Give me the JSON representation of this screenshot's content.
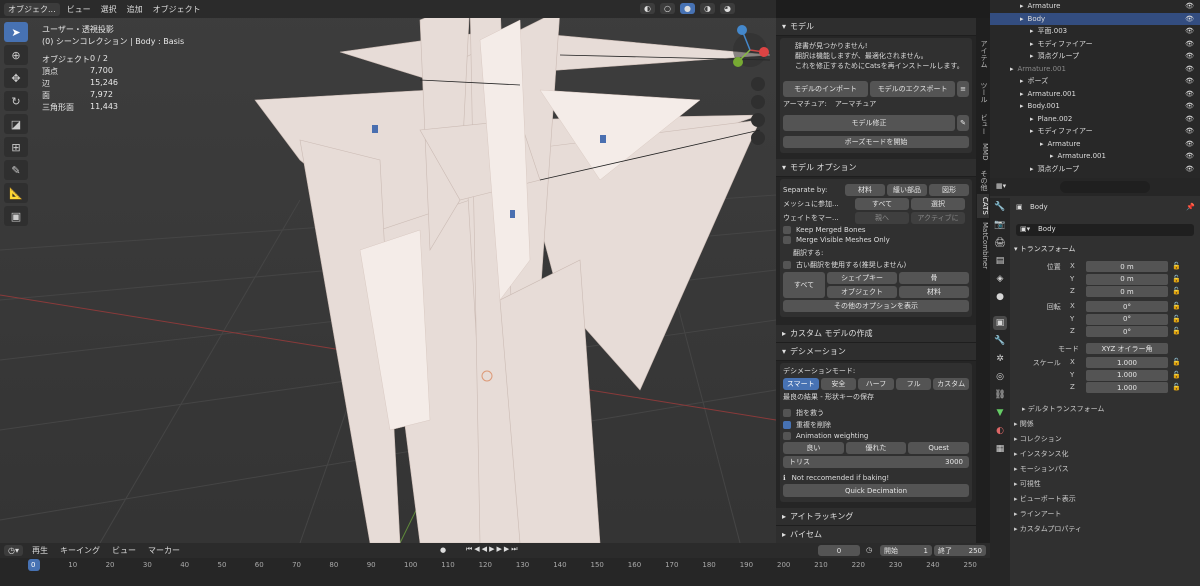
{
  "viewport": {
    "header": {
      "mode": "オブジェク...",
      "menus": [
        "ビュー",
        "選択",
        "追加",
        "オブジェクト"
      ]
    },
    "overlay": {
      "view_name": "ユーザー・透視投影",
      "collection": "(0) シーンコレクション | Body : Basis"
    },
    "stats": [
      {
        "label": "オブジェクト",
        "value": "0 / 2"
      },
      {
        "label": "頂点",
        "value": "7,700"
      },
      {
        "label": "辺",
        "value": "15,246"
      },
      {
        "label": "面",
        "value": "7,972"
      },
      {
        "label": "三角形面",
        "value": "11,443"
      }
    ]
  },
  "npanel": {
    "model_title": "モデル",
    "warning_lines": [
      "辞書が見つかりません!",
      "翻訳は機能しますが、最適化されません。",
      "これを修正するためにCatsを再インストールします。"
    ],
    "import_btn": "モデルのインポート",
    "export_btn": "モデルのエクスポート",
    "armature_label": "アーマチュア:",
    "armature_value": "アーマチュア",
    "fix_btn": "モデル修正",
    "pose_btn": "ポーズモードを開始",
    "options_title": "モデル オプション",
    "separate_by": "Separate by:",
    "sep_opts": [
      "材料",
      "緩い部品",
      "図形"
    ],
    "join_label": "メッシュに参加...",
    "join_opts": [
      "すべて",
      "選択"
    ],
    "weight_label": "ウェイトをマー...",
    "weight_opts": [
      "親へ",
      "アクティブに"
    ],
    "keep_merged": "Keep Merged Bones",
    "merge_visible": "Merge Visible Meshes Only",
    "translate_label": "翻訳する:",
    "old_translate": "古い翻訳を使用する(推奨しません)",
    "all_label": "すべて",
    "trans_opts": [
      "シェイプキー",
      "骨",
      "オブジェクト",
      "材料"
    ],
    "more_options": "その他のオプションを表示",
    "custom_title": "カスタム モデルの作成",
    "decimation_title": "デシメーション",
    "dec_mode_label": "デシメーションモード:",
    "dec_modes": [
      "スマート",
      "安全",
      "ハーフ",
      "フル",
      "カスタム"
    ],
    "dec_desc": "最良の結果 - 形状キーの保存",
    "save_fingers": "指を救う",
    "remove_doubles": "重複を削除",
    "anim_weighting": "Animation weighting",
    "quality_opts": [
      "良い",
      "優れた",
      "Quest"
    ],
    "tris_label": "トリス",
    "tris_value": "3000",
    "not_recommended": "Not reccomended if baking!",
    "quick_dec": "Quick Decimation",
    "eye_title": "アイトラッキング",
    "viseme_title": "バイセム"
  },
  "ntabs": [
    "アイテム",
    "ツール",
    "ビュー",
    "MMD",
    "その他",
    "CATS",
    "MatCombiner"
  ],
  "outliner": {
    "rows": [
      {
        "label": "Armature",
        "indent": 3,
        "dim": false,
        "selected": false
      },
      {
        "label": "Body",
        "indent": 3,
        "dim": false,
        "selected": true
      },
      {
        "label": "平面.003",
        "indent": 4,
        "dim": false,
        "selected": false
      },
      {
        "label": "モディファイアー",
        "indent": 4,
        "dim": false,
        "selected": false
      },
      {
        "label": "頂点グループ",
        "indent": 4,
        "dim": false,
        "selected": false
      },
      {
        "label": "Armature.001",
        "indent": 2,
        "dim": true,
        "selected": false
      },
      {
        "label": "ポーズ",
        "indent": 3,
        "dim": false,
        "selected": false
      },
      {
        "label": "Armature.001",
        "indent": 3,
        "dim": false,
        "selected": false
      },
      {
        "label": "Body.001",
        "indent": 3,
        "dim": false,
        "selected": false
      },
      {
        "label": "Plane.002",
        "indent": 4,
        "dim": false,
        "selected": false
      },
      {
        "label": "モディファイアー",
        "indent": 4,
        "dim": false,
        "selected": false
      },
      {
        "label": "Armature",
        "indent": 5,
        "dim": false,
        "selected": false
      },
      {
        "label": "Armature.001",
        "indent": 6,
        "dim": false,
        "selected": false
      },
      {
        "label": "頂点グループ",
        "indent": 4,
        "dim": false,
        "selected": false
      }
    ]
  },
  "properties": {
    "object_name": "Body",
    "data_name": "Body",
    "transform_title": "トランスフォーム",
    "location_label": "位置",
    "rotation_label": "回転",
    "mode_label": "モード",
    "mode_value": "XYZ オイラー角",
    "scale_label": "スケール",
    "axes": [
      "X",
      "Y",
      "Z"
    ],
    "location": [
      "0 m",
      "0 m",
      "0 m"
    ],
    "rotation": [
      "0°",
      "0°",
      "0°"
    ],
    "scale": [
      "1.000",
      "1.000",
      "1.000"
    ],
    "sections": [
      "デルタトランスフォーム",
      "関係",
      "コレクション",
      "インスタンス化",
      "モーションパス",
      "可視性",
      "ビューポート表示",
      "ラインアート",
      "カスタムプロパティ"
    ]
  },
  "timeline": {
    "playback": "再生",
    "keying": "キーイング",
    "view": "ビュー",
    "marker": "マーカー",
    "current_frame": "0",
    "start_label": "開始",
    "start_value": "1",
    "end_label": "終了",
    "end_value": "250",
    "ticks": [
      "0",
      "10",
      "20",
      "30",
      "40",
      "50",
      "60",
      "70",
      "80",
      "90",
      "100",
      "110",
      "120",
      "130",
      "140",
      "150",
      "160",
      "170",
      "180",
      "190",
      "200",
      "210",
      "220",
      "230",
      "240",
      "250"
    ]
  },
  "colors": {
    "accent": "#4772b3",
    "selected_row": "#334d80"
  }
}
